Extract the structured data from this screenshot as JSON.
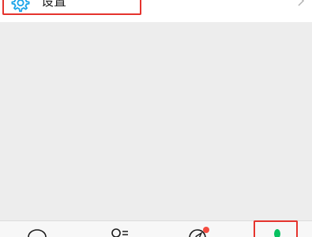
{
  "settings": {
    "label": "设置",
    "icon": "gear-icon",
    "chevron_icon": "chevron-right-icon"
  },
  "tabbar": {
    "tabs": [
      {
        "name": "chats",
        "icon": "chat-bubble-icon"
      },
      {
        "name": "contacts",
        "icon": "contacts-icon"
      },
      {
        "name": "discover",
        "icon": "compass-icon",
        "badge": true
      },
      {
        "name": "me",
        "icon": "person-icon",
        "selected": true
      }
    ]
  },
  "colors": {
    "accent": "#07c160",
    "badge": "#f44b3f",
    "highlight": "#e5332d",
    "icon_blue": "#1aa3e8",
    "background": "#ededed"
  }
}
